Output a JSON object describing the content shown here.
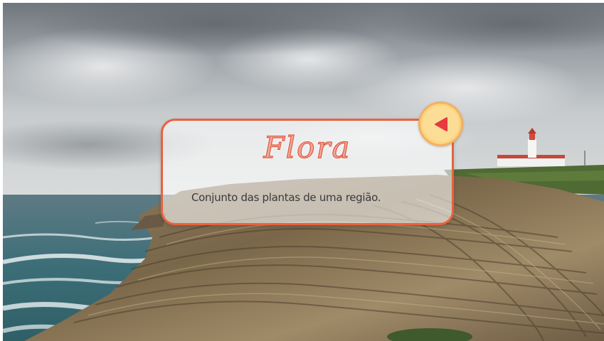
{
  "card": {
    "title": "Flora",
    "description": "Conjunto das plantas de uma região."
  },
  "back_button": {
    "icon": "triangle-left-icon"
  },
  "colors": {
    "card_border": "#e8623d",
    "title_fill": "#f2a79a",
    "button_fill": "#fbd57e",
    "button_icon": "#e8393f"
  }
}
